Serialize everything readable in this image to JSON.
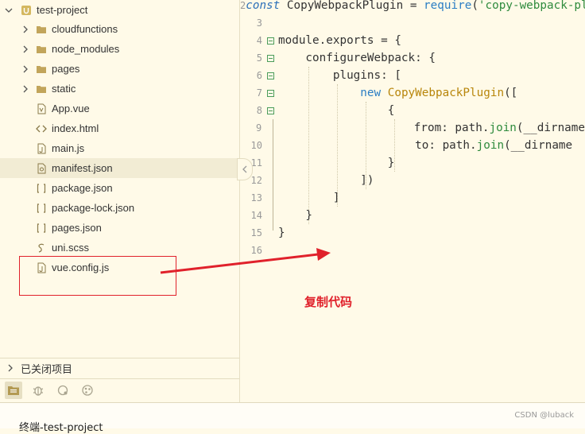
{
  "sidebar": {
    "project_name": "test-project",
    "items": [
      {
        "label": "cloudfunctions",
        "type": "folder",
        "expandable": true
      },
      {
        "label": "node_modules",
        "type": "folder",
        "expandable": true
      },
      {
        "label": "pages",
        "type": "folder",
        "expandable": true
      },
      {
        "label": "static",
        "type": "folder",
        "expandable": true
      },
      {
        "label": "App.vue",
        "type": "vue-file"
      },
      {
        "label": "index.html",
        "type": "html-file"
      },
      {
        "label": "main.js",
        "type": "js-file"
      },
      {
        "label": "manifest.json",
        "type": "manifest-file",
        "selected": true
      },
      {
        "label": "package.json",
        "type": "json-file"
      },
      {
        "label": "package-lock.json",
        "type": "json-file"
      },
      {
        "label": "pages.json",
        "type": "json-file"
      },
      {
        "label": "uni.scss",
        "type": "scss-file"
      },
      {
        "label": "vue.config.js",
        "type": "js-file"
      }
    ],
    "closed_projects_label": "已关闭项目"
  },
  "editor": {
    "lines": [
      {
        "n": "2",
        "t": [
          [
            "kw-i",
            "const"
          ],
          [
            "",
            "&#32;CopyWebpackPlugin = "
          ],
          [
            "kw",
            "require"
          ],
          [
            "",
            "("
          ],
          [
            "str",
            "'copy-webpack-plugin'"
          ],
          [
            "",
            ")"
          ]
        ]
      },
      {
        "n": "3",
        "t": []
      },
      {
        "n": "4",
        "t": [
          [
            "",
            "module.exports = {"
          ]
        ],
        "fold": true
      },
      {
        "n": "5",
        "t": [
          [
            "",
            "    configureWebpack: {"
          ]
        ],
        "fold": true
      },
      {
        "n": "6",
        "t": [
          [
            "",
            "        plugins: ["
          ]
        ],
        "fold": true
      },
      {
        "n": "7",
        "t": [
          [
            "",
            "            "
          ],
          [
            "kw",
            "new"
          ],
          [
            "",
            ""
          ],
          [
            "cls",
            "&#32;CopyWebpackPlugin"
          ],
          [
            "",
            "(["
          ]
        ],
        "fold": true
      },
      {
        "n": "8",
        "t": [
          [
            "",
            "                {"
          ]
        ],
        "fold": true
      },
      {
        "n": "9",
        "t": [
          [
            "",
            "                    from: path."
          ],
          [
            "fn",
            "join"
          ],
          [
            "",
            "(__dirname"
          ]
        ]
      },
      {
        "n": "10",
        "t": [
          [
            "",
            "                    to: path."
          ],
          [
            "fn",
            "join"
          ],
          [
            "",
            "(__dirname"
          ]
        ]
      },
      {
        "n": "11",
        "t": [
          [
            "",
            "                }"
          ]
        ]
      },
      {
        "n": "12",
        "t": [
          [
            "",
            "            ])"
          ]
        ]
      },
      {
        "n": "13",
        "t": [
          [
            "",
            "        ]"
          ]
        ]
      },
      {
        "n": "14",
        "t": [
          [
            "",
            "    }"
          ]
        ]
      },
      {
        "n": "15",
        "t": [
          [
            "",
            "}"
          ]
        ]
      },
      {
        "n": "16",
        "t": []
      }
    ]
  },
  "annotation": {
    "text": "复制代码",
    "color": "#e0212b"
  },
  "bottom": {
    "terminal_tab": "终端-test-project",
    "watermark": "CSDN @luback"
  }
}
